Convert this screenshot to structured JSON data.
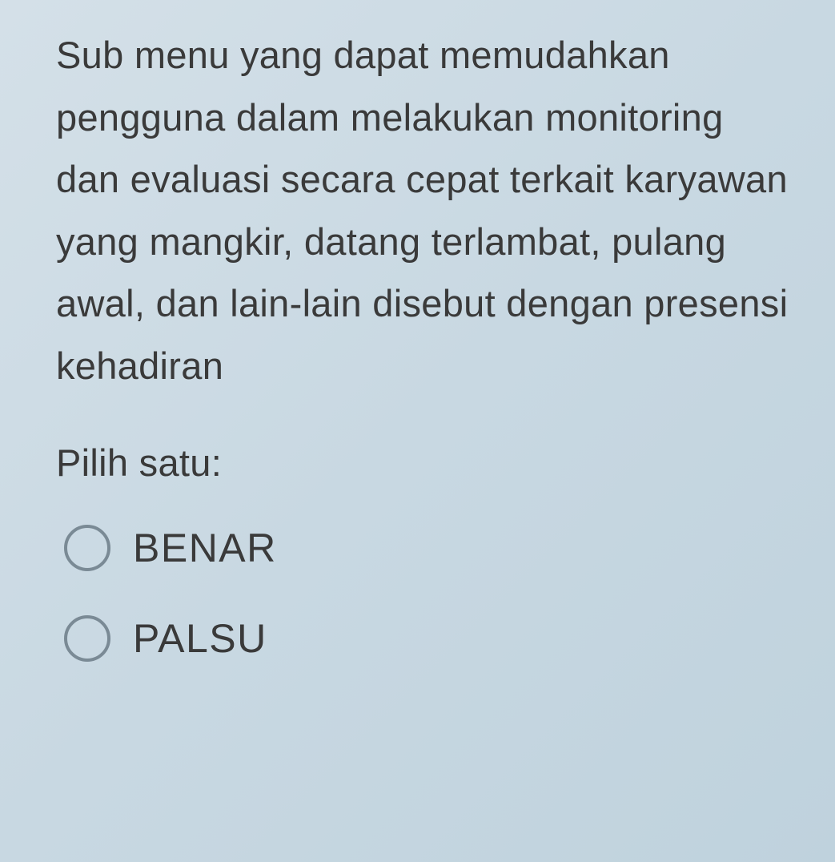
{
  "question": {
    "text": "Sub menu yang dapat memudahkan pengguna dalam melakukan monitoring dan evaluasi secara cepat terkait karyawan yang mangkir, datang terlambat, pulang awal, dan lain-lain disebut dengan presensi kehadiran"
  },
  "prompt": "Pilih satu:",
  "options": [
    {
      "label": "BENAR"
    },
    {
      "label": "PALSU"
    }
  ]
}
